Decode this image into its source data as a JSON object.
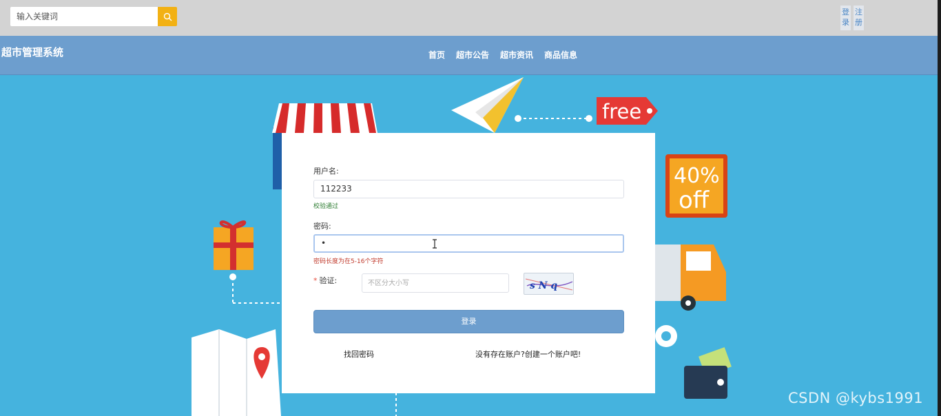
{
  "search": {
    "placeholder": "输入关键词"
  },
  "auth": {
    "login_label": "登录",
    "register_label": "注册"
  },
  "brand": "超市管理系统",
  "nav": {
    "items": [
      "首页",
      "超市公告",
      "超市资讯",
      "商品信息"
    ]
  },
  "decor": {
    "free_tag": "free",
    "discount": "40%",
    "discount_sub": "off"
  },
  "form": {
    "username_label": "用户名:",
    "username_value": "112233",
    "username_ok": "校验通过",
    "password_label": "密码:",
    "password_value": "•",
    "password_error": "密码长度为在5-16个字符",
    "captcha_required": "*",
    "captcha_label": "验证:",
    "captcha_placeholder": "不区分大小写",
    "captcha_text": "s N q",
    "login_button": "登录",
    "forgot_link": "找回密码",
    "register_link": "没有存在账户?创建一个账户吧!"
  },
  "watermark": "CSDN @kybs1991",
  "colors": {
    "navbar": "#6d9ece",
    "search_button": "#f2b114",
    "background": "#45b3de",
    "ok": "#2e7d32",
    "error": "#c0392b"
  }
}
